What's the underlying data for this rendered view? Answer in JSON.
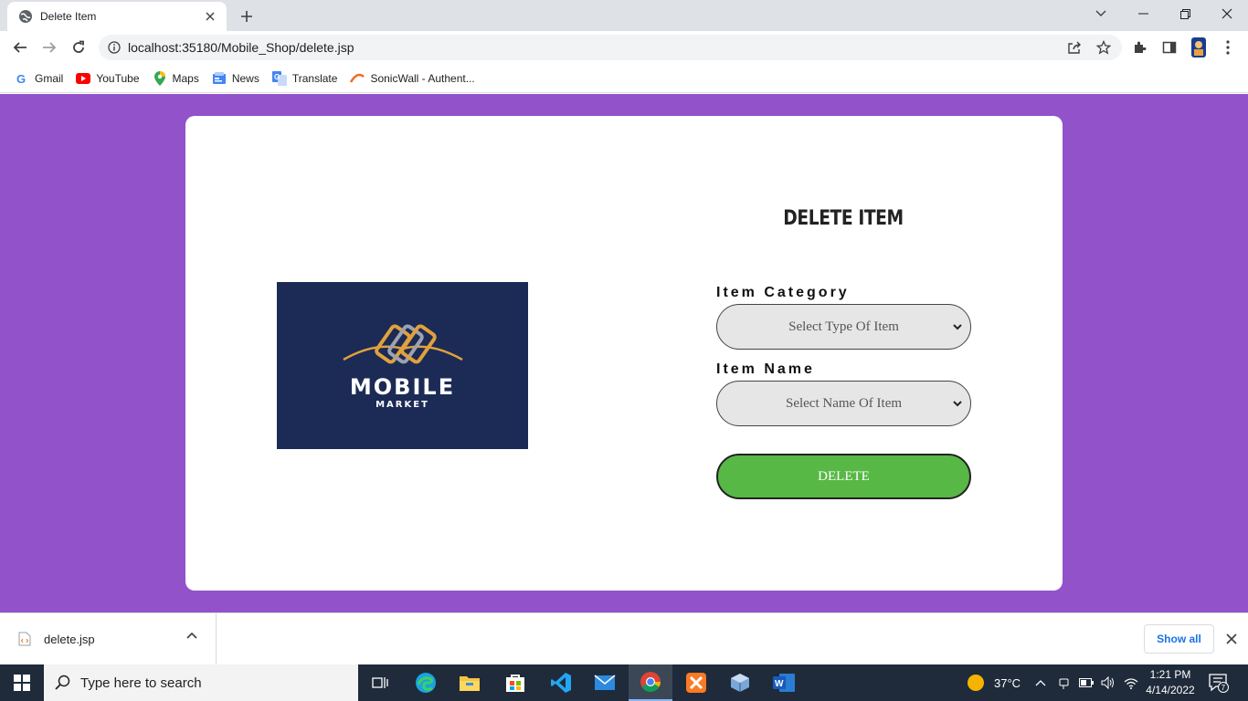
{
  "browser": {
    "tab_title": "Delete Item",
    "url": "localhost:35180/Mobile_Shop/delete.jsp",
    "bookmarks": [
      {
        "label": "Gmail",
        "icon": "gmail-icon"
      },
      {
        "label": "YouTube",
        "icon": "youtube-icon"
      },
      {
        "label": "Maps",
        "icon": "maps-icon"
      },
      {
        "label": "News",
        "icon": "news-icon"
      },
      {
        "label": "Translate",
        "icon": "translate-icon"
      },
      {
        "label": "SonicWall - Authent...",
        "icon": "sonicwall-icon"
      }
    ]
  },
  "page": {
    "background_color": "#9152ca",
    "logo": {
      "word": "MOBILE",
      "sub": "MARKET"
    },
    "form": {
      "title": "DELETE ITEM",
      "category_label": "Item Category",
      "category_value": "Select Type Of Item",
      "name_label": "Item Name",
      "name_value": "Select Name Of Item",
      "delete_label": "DELETE",
      "delete_color": "#57b846"
    }
  },
  "downloads": {
    "file": "delete.jsp",
    "show_all": "Show all"
  },
  "taskbar": {
    "search_placeholder": "Type here to search",
    "weather": "37°C",
    "time": "1:21 PM",
    "date": "4/14/2022",
    "notification_count": "7"
  }
}
